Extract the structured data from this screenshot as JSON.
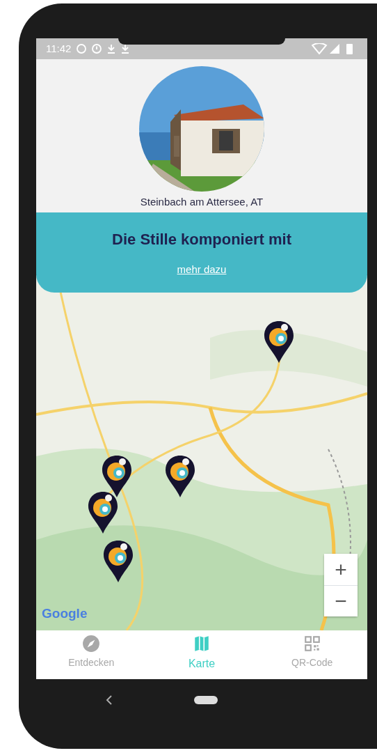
{
  "status_bar": {
    "time": "11:42"
  },
  "place": {
    "kind": "picture",
    "location": "Steinbach am Attersee, AT"
  },
  "banner": {
    "title": "Die Stille komponiert mit",
    "link": "mehr dazu"
  },
  "map": {
    "kind": "picture",
    "zoom_in": "+",
    "zoom_out": "−",
    "attribution": "Google"
  },
  "tabs": [
    {
      "kind": "compass",
      "label": "Entdecken",
      "selected": false
    },
    {
      "kind": "map",
      "label": "Karte",
      "selected": true
    },
    {
      "kind": "qr",
      "label": "QR-Code",
      "selected": false
    }
  ]
}
